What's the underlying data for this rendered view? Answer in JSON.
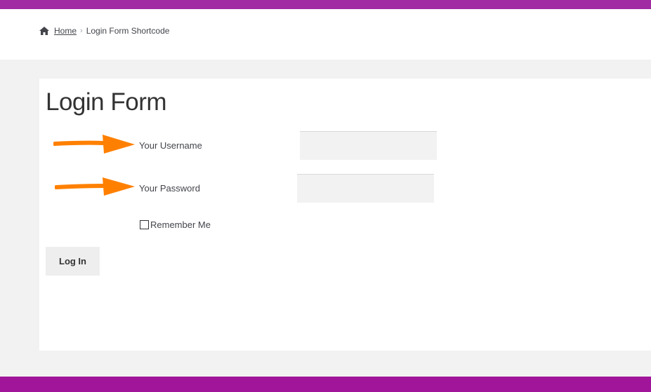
{
  "colors": {
    "top_bar": "#a02ba3",
    "bottom_bar": "#a0159a",
    "arrow": "#ff8000",
    "page_bg": "#f2f2f2"
  },
  "breadcrumb": {
    "icon": "home-icon",
    "home_label": "Home",
    "separator": "›",
    "current": "Login Form Shortcode"
  },
  "form": {
    "title": "Login Form",
    "username_label": "Your Username",
    "username_value": "",
    "password_label": "Your Password",
    "password_value": "",
    "remember_label": "Remember Me",
    "remember_checked": false,
    "submit_label": "Log In"
  },
  "annotations": {
    "arrow_icon": "arrow-right-icon"
  }
}
